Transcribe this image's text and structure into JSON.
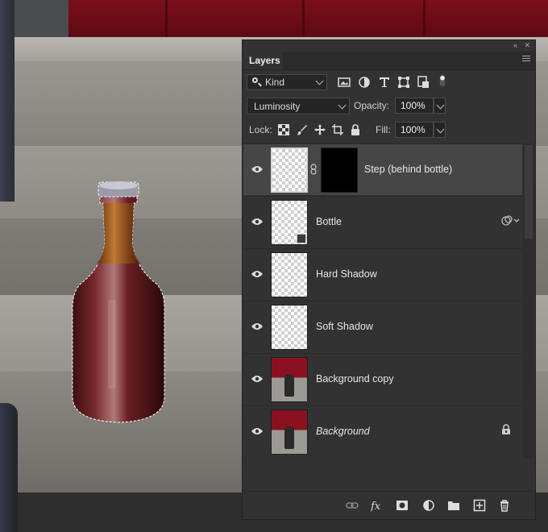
{
  "panel": {
    "tab_label": "Layers",
    "filter": {
      "kind_label": "Kind",
      "icons": [
        "image-filter-icon",
        "adjustment-filter-icon",
        "type-filter-icon",
        "shape-filter-icon",
        "smart-object-filter-icon",
        "filter-toggle-icon"
      ]
    },
    "blend_mode": "Luminosity",
    "opacity_label": "Opacity:",
    "opacity_value": "100%",
    "lock_label": "Lock:",
    "fill_label": "Fill:",
    "fill_value": "100%",
    "lock_icons": [
      "lock-transparent-icon",
      "lock-paint-icon",
      "lock-position-icon",
      "lock-artboard-icon",
      "lock-all-icon"
    ]
  },
  "layers": [
    {
      "name": "Step (behind bottle)",
      "visible": true,
      "selected": true,
      "has_mask": true,
      "thumb": "transparent"
    },
    {
      "name": "Bottle",
      "visible": true,
      "selected": false,
      "smart_object": true,
      "has_effects": true,
      "thumb": "transparent"
    },
    {
      "name": "Hard Shadow",
      "visible": true,
      "selected": false,
      "thumb": "transparent"
    },
    {
      "name": "Soft Shadow",
      "visible": true,
      "selected": false,
      "thumb": "transparent"
    },
    {
      "name": "Background copy",
      "visible": true,
      "selected": false,
      "thumb": "photo"
    },
    {
      "name": "Background",
      "visible": true,
      "selected": false,
      "locked": true,
      "italic": true,
      "thumb": "photo"
    }
  ],
  "bottom_icons": [
    "link-layers-icon",
    "fx-icon",
    "add-mask-icon",
    "adjustment-layer-icon",
    "new-group-icon",
    "new-layer-icon",
    "delete-icon"
  ],
  "colors": {
    "panel_bg": "#323232",
    "selected_row": "#464646",
    "door_red": "#7a0f1a"
  }
}
